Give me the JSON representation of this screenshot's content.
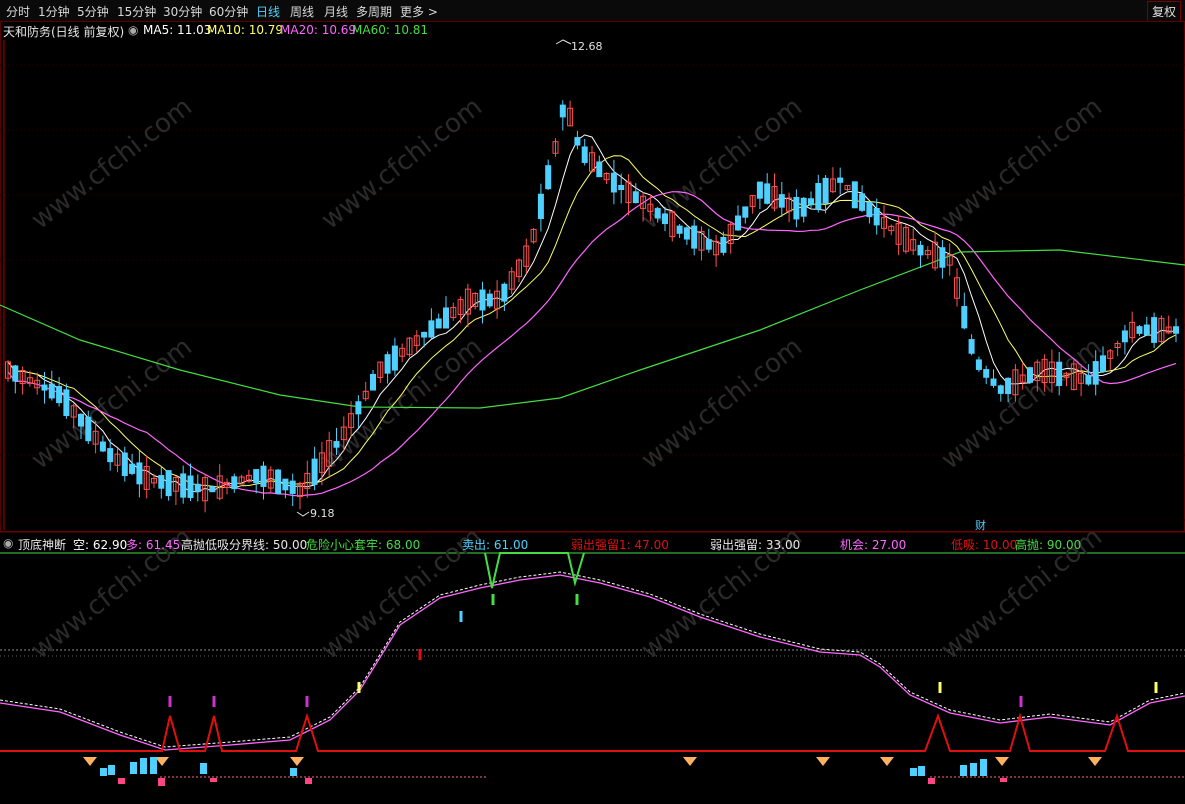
{
  "toolbar": {
    "tabs": [
      {
        "label": "分时",
        "active": false
      },
      {
        "label": "1分钟",
        "active": false
      },
      {
        "label": "5分钟",
        "active": false
      },
      {
        "label": "15分钟",
        "active": false
      },
      {
        "label": "30分钟",
        "active": false
      },
      {
        "label": "60分钟",
        "active": false
      },
      {
        "label": "日线",
        "active": true
      },
      {
        "label": "周线",
        "active": false
      },
      {
        "label": "月线",
        "active": false
      },
      {
        "label": "多周期",
        "active": false
      },
      {
        "label": "更多",
        "active": false
      }
    ],
    "right_button": "复权"
  },
  "main_info": {
    "stock": "天和防务(日线 前复权)",
    "ma5": "MA5: 11.03",
    "ma10": "MA10: 10.79",
    "ma20": "MA20: 10.69",
    "ma60": "MA60: 10.81"
  },
  "annotations": {
    "high": "12.68",
    "low": "9.18",
    "cai": "财"
  },
  "indicator": {
    "name": "顶底神断",
    "kong": "空: 62.90",
    "duo": "多: 61.45",
    "boundary": "高抛低吸分界线: 50.00",
    "danger": "危险小心套牢: 68.00",
    "sell": "卖出: 61.00",
    "weak1": "弱出强留1: 47.00",
    "weak": "弱出强留: 33.00",
    "chance": "机会: 27.00",
    "dixi": "低吸: 10.00",
    "gaopao": "高抛: 90.00"
  },
  "watermark": "www.cfchi.com",
  "colors": {
    "up": "#ff5050",
    "down": "#4fd0ff",
    "ma5": "#ffffff",
    "ma10": "#ffff66",
    "ma20": "#ff66ff",
    "ma60": "#44dd44",
    "line_red": "#e01010"
  }
}
